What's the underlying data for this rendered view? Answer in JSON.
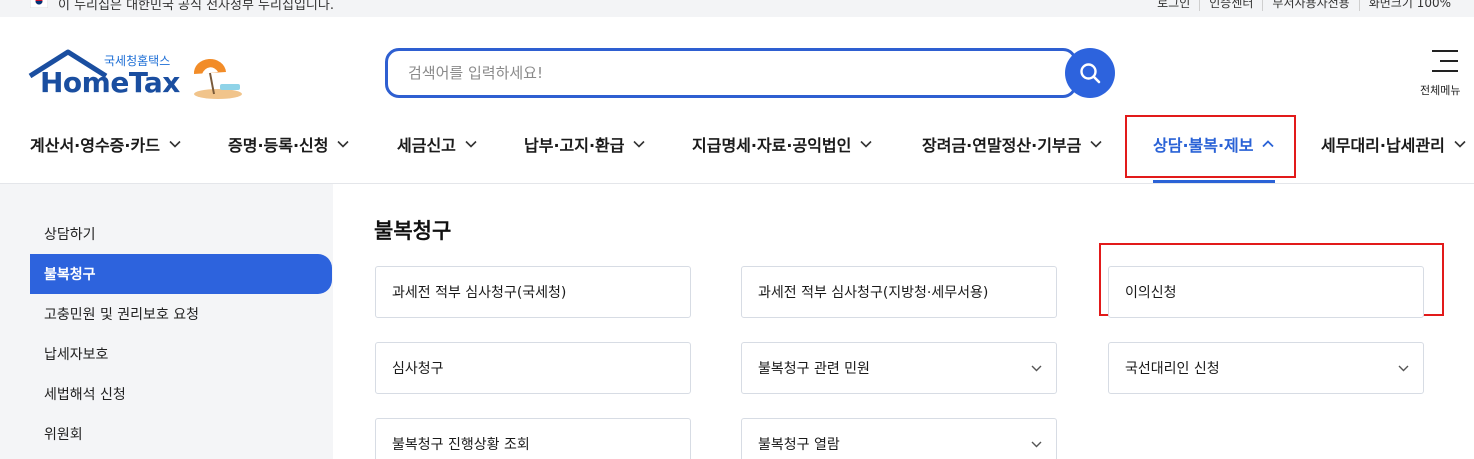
{
  "topbar": {
    "gov_notice": "이 누리집은 대한민국 공식 전자정부 누리집입니다.",
    "util_links": [
      "로그인",
      "인증센터",
      "부서사용자전용",
      "화면크기 100%"
    ]
  },
  "logo": {
    "sub": "국세청홈택스",
    "main": "HomeTax"
  },
  "search": {
    "placeholder": "검색어를 입력하세요!"
  },
  "allmenu": {
    "label": "전체메뉴"
  },
  "gnb": {
    "items": [
      "계산서·영수증·카드",
      "증명·등록·신청",
      "세금신고",
      "납부·고지·환급",
      "지급명세·자료·공익법인",
      "장려금·연말정산·기부금",
      "상담·불복·제보",
      "세무대리·납세관리"
    ],
    "active_index": 6
  },
  "sidebar": {
    "items": [
      "상담하기",
      "불복청구",
      "고충민원 및 권리보호 요청",
      "납세자보호",
      "세법해석 신청",
      "위원회"
    ],
    "active_index": 1
  },
  "content": {
    "title": "불복청구",
    "cards": [
      "과세전 적부 심사청구(국세청)",
      "과세전 적부 심사청구(지방청·세무서용)",
      "이의신청",
      "심사청구",
      "불복청구 관련 민원",
      "국선대리인 신청",
      "불복청구 진행상황 조회",
      "불복청구 열람"
    ]
  },
  "colors": {
    "accent": "#2d63dd",
    "highlight_box": "#e21a1a",
    "sidebar_bg": "#f4f5f7",
    "logo_blue": "#1a4ea0"
  }
}
